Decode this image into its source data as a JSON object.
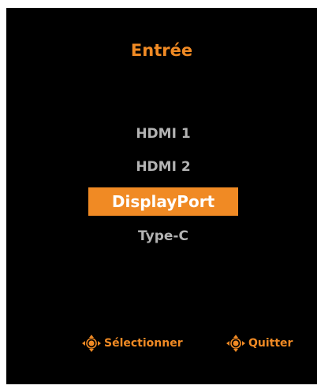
{
  "osd": {
    "title": "Entrée",
    "items": [
      {
        "label": "HDMI 1",
        "selected": false
      },
      {
        "label": "HDMI 2",
        "selected": false
      },
      {
        "label": "DisplayPort",
        "selected": true
      },
      {
        "label": "Type-C",
        "selected": false
      }
    ],
    "footer": {
      "select_label": "Sélectionner",
      "select_icon": "joystick-icon",
      "exit_label": "Quitter",
      "exit_icon": "joystick-icon"
    }
  },
  "colors": {
    "accent": "#f08a24",
    "background": "#000000",
    "text_inactive": "#b3b3b3",
    "text_selected": "#ffffff"
  }
}
